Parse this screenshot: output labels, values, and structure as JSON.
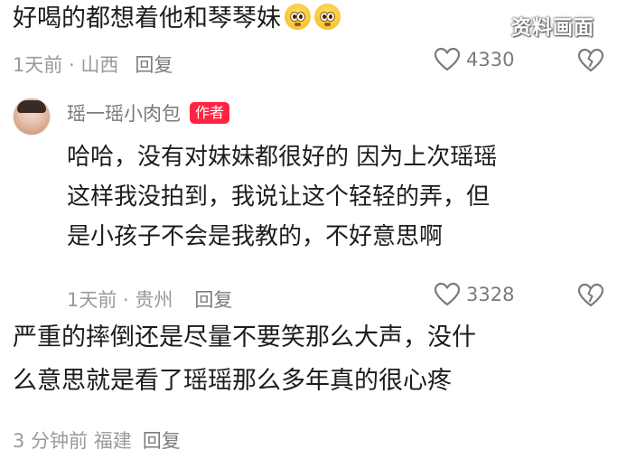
{
  "comment1": {
    "text": "好喝的都想着他和琴琴妹",
    "meta": "1天前 · 山西",
    "reply": "回复",
    "likes": "4330",
    "emoji": [
      "woozy-face-emoji",
      "woozy-face-emoji"
    ]
  },
  "watermark": "资料画面",
  "reply1": {
    "username": "瑶一瑶小肉包",
    "badge": "作者",
    "lines": [
      "哈哈，没有对妹妹都很好的 因为上次瑶瑶",
      "这样我没拍到，我说让这个轻轻的弄，但",
      "是小孩子不会是我教的，不好意思啊"
    ],
    "meta": "1天前 · 贵州",
    "reply": "回复",
    "likes": "3328"
  },
  "comment2": {
    "lines": [
      "严重的摔倒还是尽量不要笑那么大声，没什",
      "么意思就是看了瑶瑶那么多年真的很心疼"
    ],
    "meta": "3 分钟前  福建",
    "reply": "回复"
  },
  "colors": {
    "badge": "#ff2442",
    "meta": "#9a9a9a",
    "text": "#1c1c1c"
  }
}
